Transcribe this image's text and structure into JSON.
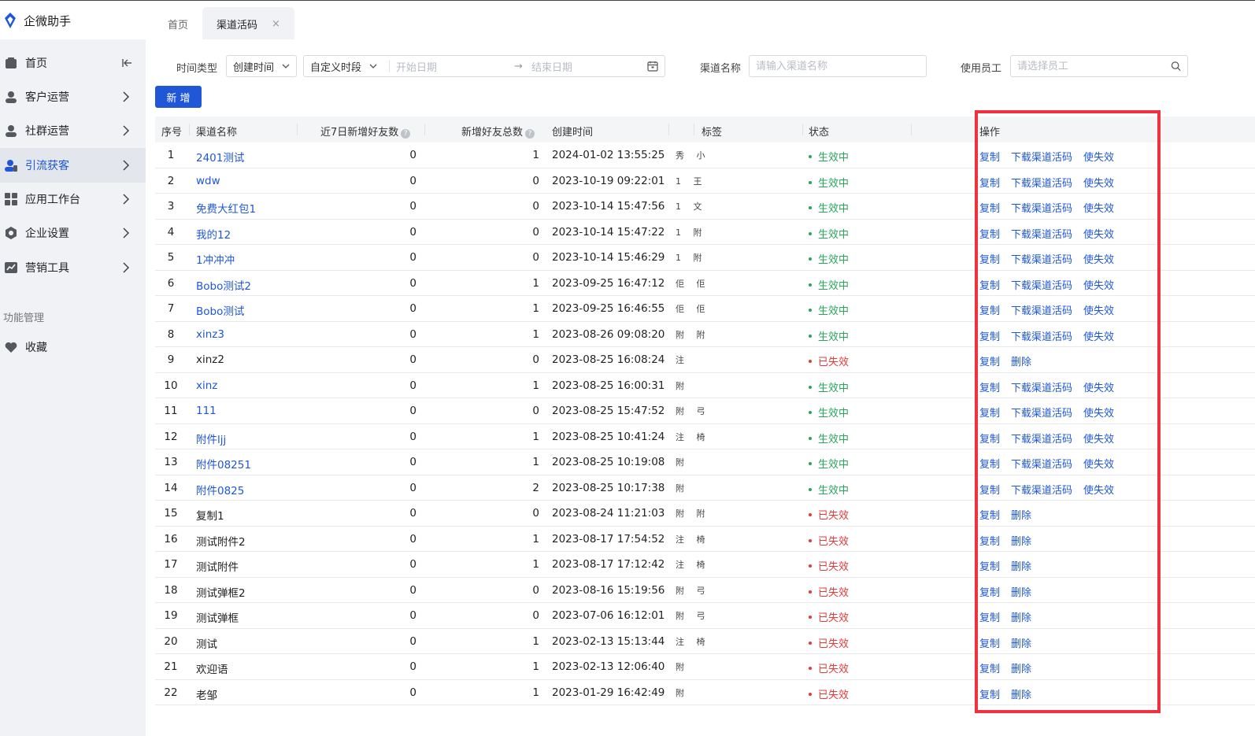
{
  "app": {
    "title": "企微助手"
  },
  "tabs": [
    {
      "label": "首页",
      "closable": false
    },
    {
      "label": "渠道活码",
      "closable": true,
      "close_glyph": "×"
    }
  ],
  "sidebar": {
    "items": [
      {
        "label": "首页",
        "icon": "home-icon",
        "active": false
      },
      {
        "label": "客户运营",
        "icon": "customer-icon",
        "active": false
      },
      {
        "label": "社群运营",
        "icon": "group-icon",
        "active": false
      },
      {
        "label": "引流获客",
        "icon": "lead-icon",
        "active": true
      },
      {
        "label": "应用工作台",
        "icon": "apps-icon",
        "active": false
      },
      {
        "label": "企业设置",
        "icon": "settings-icon",
        "active": false
      },
      {
        "label": "营销工具",
        "icon": "chart-icon",
        "active": false
      }
    ],
    "section_title": "功能管理",
    "favorites": {
      "label": "收藏",
      "icon": "heart-icon"
    }
  },
  "filters": {
    "time_type_label": "时间类型",
    "time_type_value": "创建时间",
    "period_value": "自定义时段",
    "start_placeholder": "开始日期",
    "end_placeholder": "结束日期",
    "range_sep": "→",
    "channel_label": "渠道名称",
    "channel_placeholder": "请输入渠道名称",
    "staff_label": "使用员工",
    "staff_placeholder": "请选择员工"
  },
  "add_button": "新 增",
  "table": {
    "headers": {
      "idx": "序号",
      "name": "渠道名称",
      "new7": "近7日新增好友数",
      "total": "新增好友总数",
      "created": "创建时间",
      "tags": "标签",
      "status": "状态",
      "ops": "操作"
    },
    "help_glyph": "?",
    "ops_labels": {
      "copy": "复制",
      "download": "下载渠道活码",
      "disable": "使失效",
      "delete": "删除"
    },
    "status_labels": {
      "on": "生效中",
      "off": "已失效"
    },
    "rows": [
      {
        "idx": "1",
        "name": "2401测试",
        "new7": "0",
        "total": "1",
        "created": "2024-01-02 13:55:25",
        "tags": "秀 小",
        "active": true
      },
      {
        "idx": "2",
        "name": "wdw",
        "new7": "0",
        "total": "0",
        "created": "2023-10-19 09:22:01",
        "tags": "1 王",
        "active": true
      },
      {
        "idx": "3",
        "name": "免费大红包1",
        "new7": "0",
        "total": "0",
        "created": "2023-10-14 15:47:56",
        "tags": "1 文",
        "active": true
      },
      {
        "idx": "4",
        "name": "我的12",
        "new7": "0",
        "total": "0",
        "created": "2023-10-14 15:47:22",
        "tags": "1 附",
        "active": true
      },
      {
        "idx": "5",
        "name": "1冲冲冲",
        "new7": "0",
        "total": "0",
        "created": "2023-10-14 15:46:29",
        "tags": "1 附",
        "active": true
      },
      {
        "idx": "6",
        "name": "Bobo测试2",
        "new7": "0",
        "total": "1",
        "created": "2023-09-25 16:47:12",
        "tags": "佢 佢",
        "active": true
      },
      {
        "idx": "7",
        "name": "Bobo测试",
        "new7": "0",
        "total": "1",
        "created": "2023-09-25 16:46:55",
        "tags": "佢 佢",
        "active": true
      },
      {
        "idx": "8",
        "name": "xinz3",
        "new7": "0",
        "total": "1",
        "created": "2023-08-26 09:08:20",
        "tags": "附 附",
        "active": true
      },
      {
        "idx": "9",
        "name": "xinz2",
        "new7": "0",
        "total": "0",
        "created": "2023-08-25 16:08:24",
        "tags": "注",
        "active": false
      },
      {
        "idx": "10",
        "name": "xinz",
        "new7": "0",
        "total": "1",
        "created": "2023-08-25 16:00:31",
        "tags": "附",
        "active": true
      },
      {
        "idx": "11",
        "name": "111",
        "new7": "0",
        "total": "0",
        "created": "2023-08-25 15:47:52",
        "tags": "附 弓",
        "active": true
      },
      {
        "idx": "12",
        "name": "附件ljj",
        "new7": "0",
        "total": "1",
        "created": "2023-08-25 10:41:24",
        "tags": "注 椅",
        "active": true
      },
      {
        "idx": "13",
        "name": "附件08251",
        "new7": "0",
        "total": "1",
        "created": "2023-08-25 10:19:08",
        "tags": "附",
        "active": true
      },
      {
        "idx": "14",
        "name": "附件0825",
        "new7": "0",
        "total": "2",
        "created": "2023-08-25 10:17:38",
        "tags": "附",
        "active": true
      },
      {
        "idx": "15",
        "name": "复制1",
        "new7": "0",
        "total": "0",
        "created": "2023-08-24 11:21:03",
        "tags": "附 附",
        "active": false
      },
      {
        "idx": "16",
        "name": "测试附件2",
        "new7": "0",
        "total": "1",
        "created": "2023-08-17 17:54:52",
        "tags": "注 椅",
        "active": false
      },
      {
        "idx": "17",
        "name": "测试附件",
        "new7": "0",
        "total": "1",
        "created": "2023-08-17 17:12:42",
        "tags": "注 椅",
        "active": false
      },
      {
        "idx": "18",
        "name": "测试弹框2",
        "new7": "0",
        "total": "0",
        "created": "2023-08-16 15:19:56",
        "tags": "附 弓",
        "active": false
      },
      {
        "idx": "19",
        "name": "测试弹框",
        "new7": "0",
        "total": "0",
        "created": "2023-07-06 16:12:01",
        "tags": "附 弓",
        "active": false
      },
      {
        "idx": "20",
        "name": "测试",
        "new7": "0",
        "total": "1",
        "created": "2023-02-13 15:13:44",
        "tags": "注 椅",
        "active": false
      },
      {
        "idx": "21",
        "name": "欢迎语",
        "new7": "0",
        "total": "1",
        "created": "2023-02-13 12:06:40",
        "tags": "附",
        "active": false
      },
      {
        "idx": "22",
        "name": "老邹",
        "new7": "0",
        "total": "1",
        "created": "2023-01-29 16:42:49",
        "tags": "附",
        "active": false
      }
    ]
  },
  "colors": {
    "accent": "#1f57d6",
    "active_status": "#2aa65c",
    "inactive_status": "#e23b3b",
    "highlight_box": "#f2313f"
  }
}
